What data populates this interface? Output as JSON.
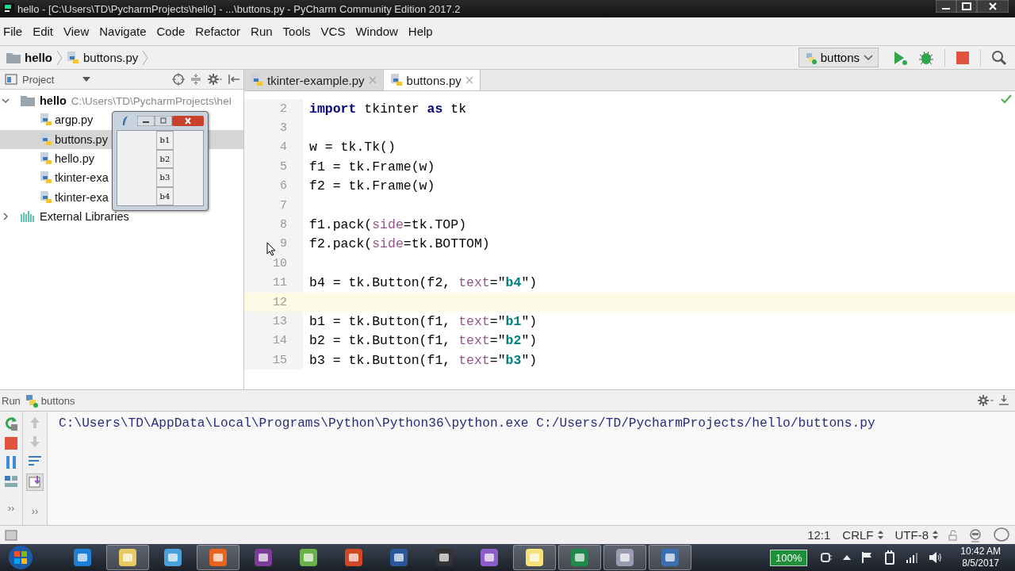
{
  "window": {
    "title": "hello - [C:\\Users\\TD\\PycharmProjects\\hello] - ...\\buttons.py - PyCharm Community Edition 2017.2"
  },
  "menu": [
    "File",
    "Edit",
    "View",
    "Navigate",
    "Code",
    "Refactor",
    "Run",
    "Tools",
    "VCS",
    "Window",
    "Help"
  ],
  "breadcrumb": [
    "hello",
    "buttons.py"
  ],
  "run_config": {
    "label": "buttons"
  },
  "project_panel": {
    "title": "Project",
    "tree": [
      {
        "name": "hello",
        "path": "C:\\Users\\TD\\PycharmProjects\\hel",
        "expanded": true,
        "selected": false,
        "children": [
          {
            "name": "argp.py",
            "selected": false
          },
          {
            "name": "buttons.py",
            "selected": true
          },
          {
            "name": "hello.py",
            "selected": false
          },
          {
            "name": "tkinter-exa",
            "selected": false
          },
          {
            "name": "tkinter-exa",
            "selected": false
          }
        ]
      },
      {
        "name": "External Libraries",
        "expanded": false,
        "selected": false
      }
    ]
  },
  "editor": {
    "tabs": [
      {
        "label": "tkinter-example.py",
        "selected": false
      },
      {
        "label": "buttons.py",
        "selected": true
      }
    ],
    "lines": [
      {
        "number": "2",
        "current": false,
        "tokens": [
          {
            "text": "import",
            "kind": "kw"
          },
          {
            "text": " tkinter ",
            "kind": "text"
          },
          {
            "text": "as",
            "kind": "kw"
          },
          {
            "text": " tk",
            "kind": "text"
          }
        ]
      },
      {
        "number": "3",
        "current": false
      },
      {
        "number": "4",
        "current": false,
        "tokens": [
          {
            "text": "w = tk.Tk()",
            "kind": "text"
          }
        ]
      },
      {
        "number": "5",
        "current": false,
        "tokens": [
          {
            "text": "f1 = tk.Frame(w)",
            "kind": "text"
          }
        ]
      },
      {
        "number": "6",
        "current": false,
        "tokens": [
          {
            "text": "f2 = tk.Frame(w)",
            "kind": "text"
          }
        ]
      },
      {
        "number": "7",
        "current": false
      },
      {
        "number": "8",
        "current": false,
        "tokens": [
          {
            "text": "f1.pack(",
            "kind": "text"
          },
          {
            "text": "side",
            "kind": "param"
          },
          {
            "text": "=tk.TOP)",
            "kind": "text"
          }
        ]
      },
      {
        "number": "9",
        "current": false,
        "tokens": [
          {
            "text": "f2.pack(",
            "kind": "text"
          },
          {
            "text": "side",
            "kind": "param"
          },
          {
            "text": "=tk.BOTTOM)",
            "kind": "text"
          }
        ]
      },
      {
        "number": "10",
        "current": false
      },
      {
        "number": "11",
        "current": false,
        "tokens": [
          {
            "text": "b4 = tk.Button(f2, ",
            "kind": "text"
          },
          {
            "text": "text",
            "kind": "param"
          },
          {
            "text": "=\"",
            "kind": "text"
          },
          {
            "text": "b4",
            "kind": "str"
          },
          {
            "text": "\")",
            "kind": "text"
          }
        ]
      },
      {
        "number": "12",
        "current": true
      },
      {
        "number": "13",
        "current": false,
        "tokens": [
          {
            "text": "b1 = tk.Button(f1, ",
            "kind": "text"
          },
          {
            "text": "text",
            "kind": "param"
          },
          {
            "text": "=\"",
            "kind": "text"
          },
          {
            "text": "b1",
            "kind": "str"
          },
          {
            "text": "\")",
            "kind": "text"
          }
        ]
      },
      {
        "number": "14",
        "current": false,
        "tokens": [
          {
            "text": "b2 = tk.Button(f1, ",
            "kind": "text"
          },
          {
            "text": "text",
            "kind": "param"
          },
          {
            "text": "=\"",
            "kind": "text"
          },
          {
            "text": "b2",
            "kind": "str"
          },
          {
            "text": "\")",
            "kind": "text"
          }
        ]
      },
      {
        "number": "15",
        "current": false,
        "tokens": [
          {
            "text": "b3 = tk.Button(f1, ",
            "kind": "text"
          },
          {
            "text": "text",
            "kind": "param"
          },
          {
            "text": "=\"",
            "kind": "text"
          },
          {
            "text": "b3",
            "kind": "str"
          },
          {
            "text": "\")",
            "kind": "text"
          }
        ]
      }
    ]
  },
  "tk_window": {
    "buttons": [
      "b1",
      "b2",
      "b3",
      "b4"
    ]
  },
  "run_panel": {
    "title": "Run",
    "overflow": [
      "››",
      "››"
    ],
    "config": "buttons",
    "output": [
      "C:\\Users\\TD\\AppData\\Local\\Programs\\Python\\Python36\\python.exe C:/Users/TD/PycharmProjects/hello/buttons.py"
    ]
  },
  "status_bar": {
    "position": "12:1",
    "line_separator": "CRLF",
    "encoding": "UTF-8"
  },
  "taskbar": {
    "buttons": [
      {
        "open": false
      },
      {
        "open": true
      },
      {
        "open": false
      },
      {
        "open": true
      },
      {
        "open": false
      },
      {
        "open": false
      },
      {
        "open": false
      },
      {
        "open": false
      },
      {
        "open": false
      },
      {
        "open": false
      },
      {
        "open": true
      },
      {
        "open": true
      },
      {
        "open": true
      },
      {
        "open": true
      }
    ],
    "battery": "100%",
    "time": "10:42 AM",
    "date": "8/5/2017"
  }
}
